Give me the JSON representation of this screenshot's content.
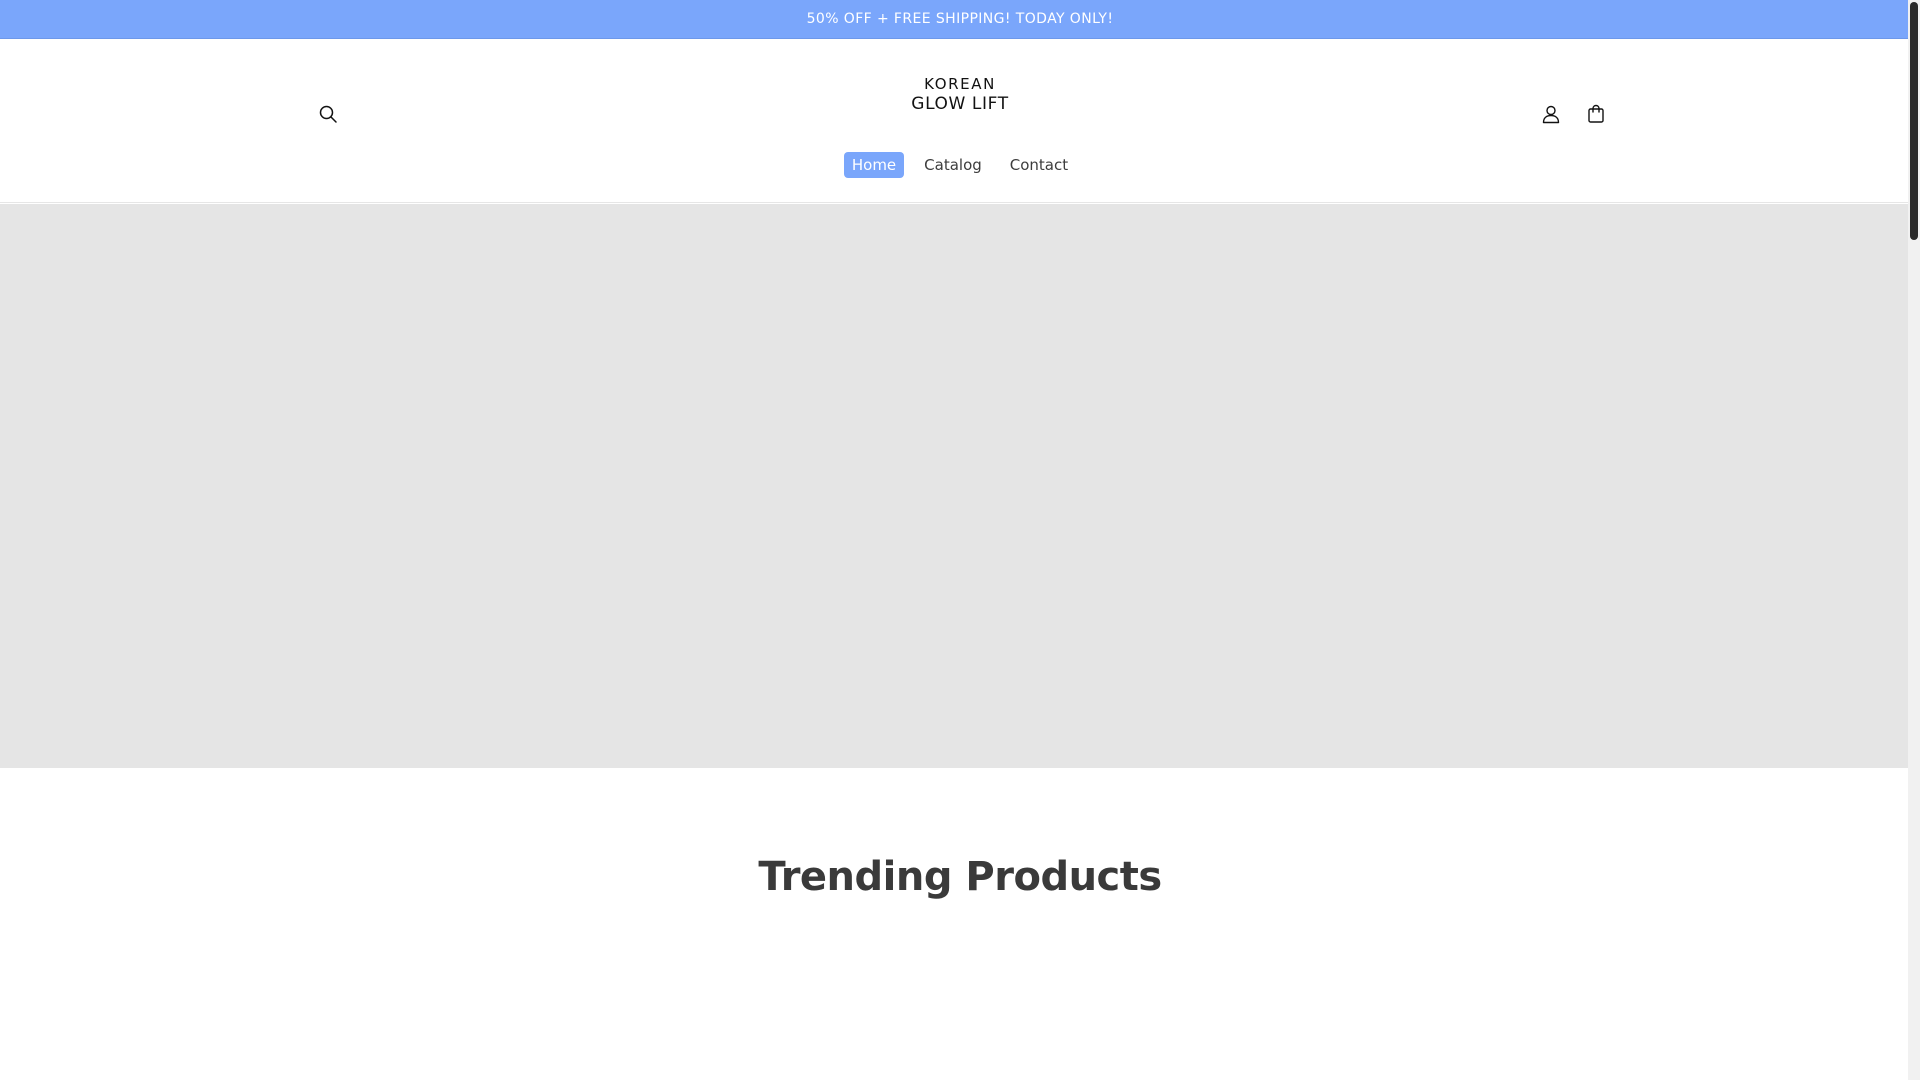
{
  "announcement": {
    "text": "50% OFF + FREE SHIPPING! TODAY ONLY!"
  },
  "header": {
    "logo": {
      "line1": "KOREAN",
      "line2": "GLOW LIFT"
    },
    "icons": {
      "search": "search-icon",
      "account": "user-icon",
      "cart": "cart-icon"
    }
  },
  "nav": {
    "items": [
      {
        "label": "Home",
        "active": true
      },
      {
        "label": "Catalog",
        "active": false
      },
      {
        "label": "Contact",
        "active": false
      }
    ]
  },
  "hero": {
    "state": "empty placeholder"
  },
  "trending": {
    "title": "Trending Products"
  },
  "colors": {
    "accent": "#7aa6fb",
    "hero_placeholder": "#e5e5e5",
    "heading": "#3a3a3a"
  }
}
